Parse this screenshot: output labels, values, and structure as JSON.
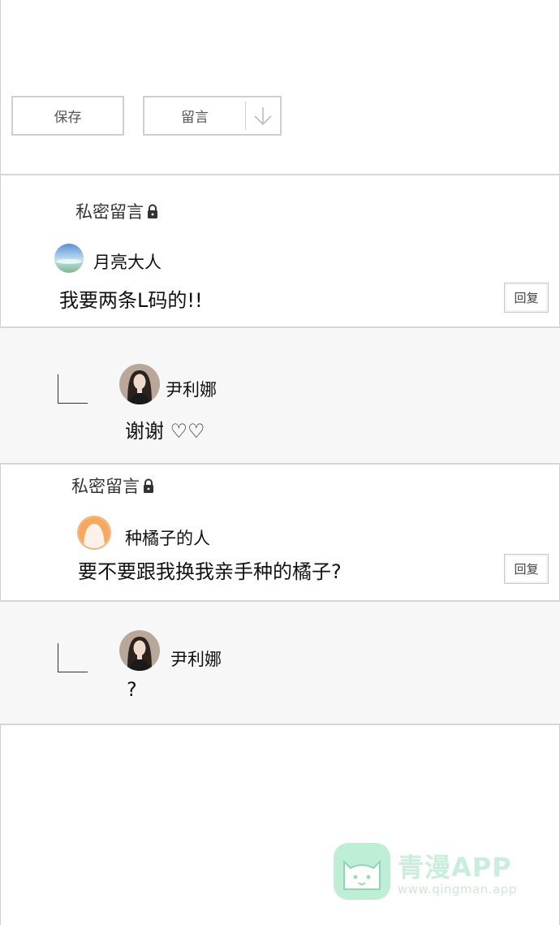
{
  "toolbar": {
    "save_label": "保存",
    "message_label": "留言"
  },
  "threads": [
    {
      "private_label": "私密留言",
      "comment": {
        "user": "月亮大人",
        "text": "我要两条L码的!!"
      },
      "reply_button": "回复",
      "reply": {
        "user": "尹利娜",
        "text": "谢谢 ♡♡"
      }
    },
    {
      "private_label": "私密留言",
      "comment": {
        "user": "种橘子的人",
        "text": "要不要跟我换我亲手种的橘子?"
      },
      "reply_button": "回复",
      "reply": {
        "user": "尹利娜",
        "text": "?"
      }
    }
  ],
  "watermark": {
    "title": "青漫APP",
    "url": "www.qingman.app"
  },
  "colors": {
    "border": "#cfcfcf",
    "reply_bg": "#f7f7f7",
    "watermark": "#a8e6c4"
  },
  "icons": [
    "lock-icon",
    "arrow-down-icon",
    "corner-reply-icon",
    "cat-logo-icon"
  ]
}
